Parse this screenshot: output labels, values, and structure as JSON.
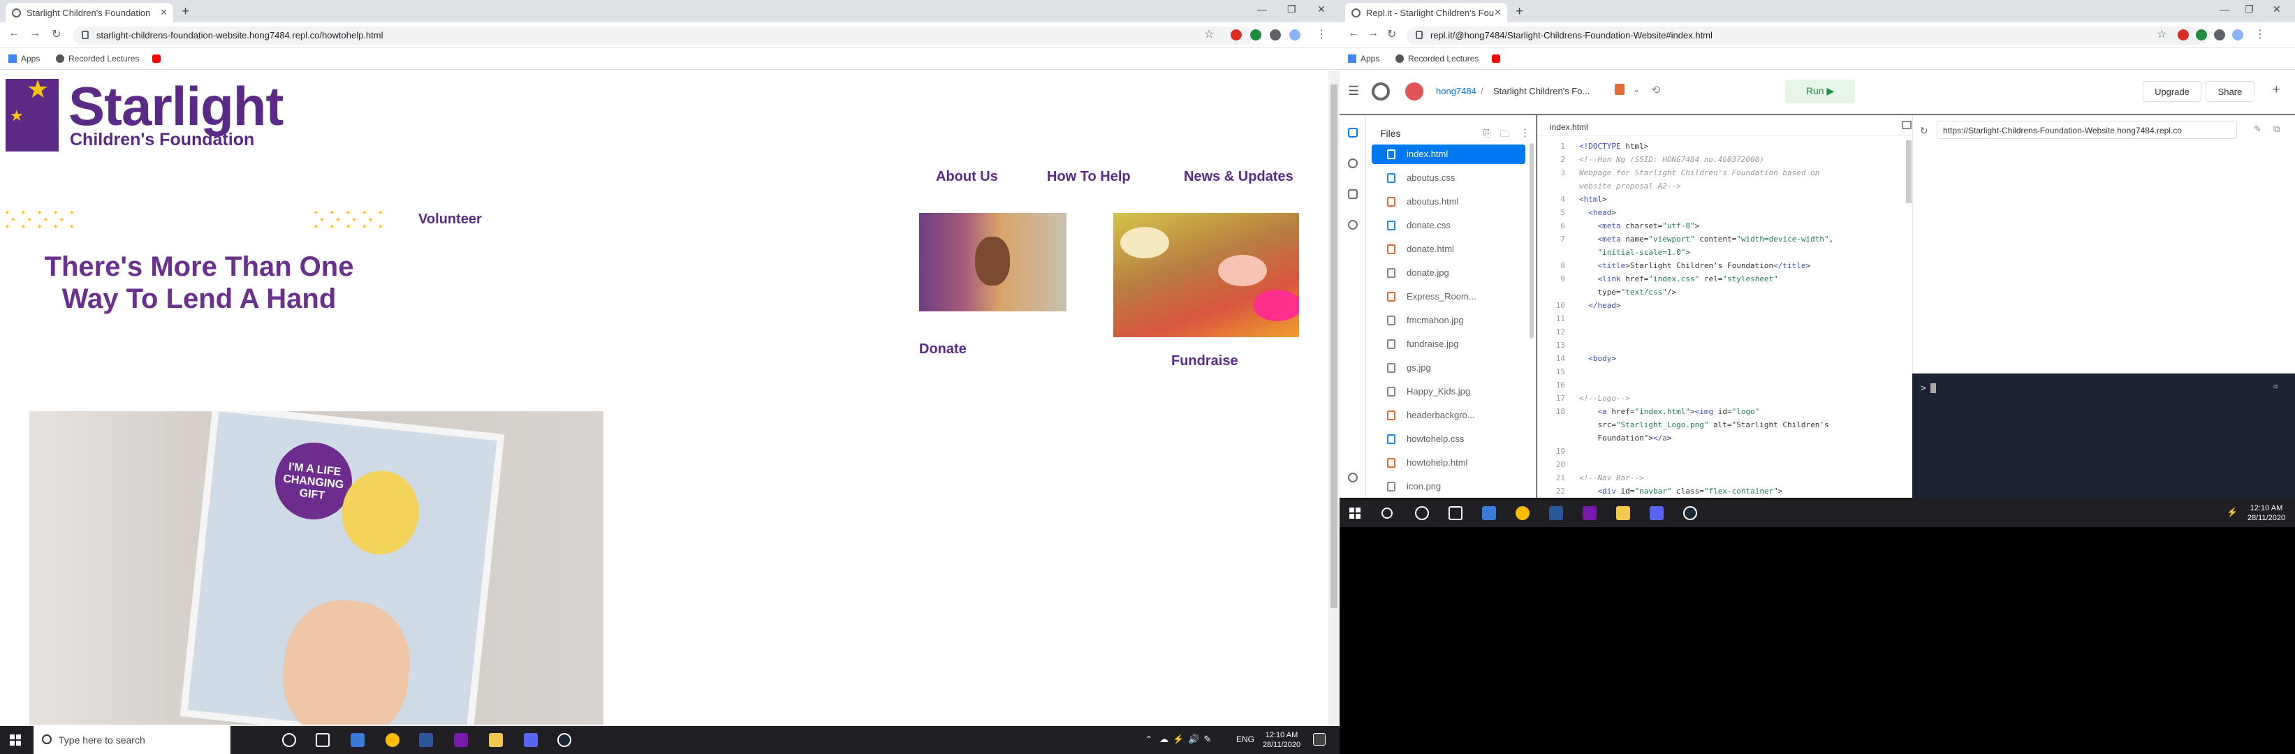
{
  "left": {
    "tab_title": "Starlight Children's Foundation",
    "url": "starlight-childrens-foundation-website.hong7484.repl.co/howtohelp.html",
    "bookmarks": [
      "Apps",
      "Recorded Lectures"
    ],
    "logo": {
      "line1": "Starlight",
      "line2": "Children's Foundation"
    },
    "nav": [
      "About Us",
      "How To Help",
      "News & Updates"
    ],
    "volunteer": "Volunteer",
    "headline": "There's More Than One Way To Lend A Hand",
    "donate": "Donate",
    "fundraise": "Fundraise",
    "badge": "I'M A LIFE CHANGING GIFT",
    "taskbar": {
      "search_placeholder": "Type here to search",
      "lang": "ENG",
      "time": "12:10 AM",
      "date": "28/11/2020"
    }
  },
  "right": {
    "tab_title": "Repl.it - Starlight Children's Fou",
    "url": "repl.it/@hong7484/Starlight-Childrens-Foundation-Website#index.html",
    "bookmarks": [
      "Apps",
      "Recorded Lectures"
    ],
    "user": "hong7484",
    "repl_name": "Starlight Children's Fo...",
    "run_label": "Run ▶",
    "upgrade_label": "Upgrade",
    "share_label": "Share",
    "files_title": "Files",
    "files": [
      "index.html",
      "aboutus.css",
      "aboutus.html",
      "donate.css",
      "donate.html",
      "donate.jpg",
      "Express_Room...",
      "fmcmahon.jpg",
      "fundraise.jpg",
      "gs.jpg",
      "Happy_Kids.jpg",
      "headerbackgro...",
      "howtohelp.css",
      "howtohelp.html",
      "icon.png"
    ],
    "editor_tab": "index.html",
    "web_url": "https://Starlight-Childrens-Foundation-Website.hong7484.repl.co",
    "console_prompt": ">",
    "taskbar": {
      "time": "12:10 AM",
      "date": "28/11/2020"
    }
  },
  "code_lines": [
    [
      "1",
      "<!DOCTYPE html>"
    ],
    [
      "2",
      "<!--Hon Ng (SSID: HONG7484 no.460372008)"
    ],
    [
      "3",
      "Webpage for Starlight Children's Foundation based on"
    ],
    [
      "",
      "website proposal A2-->"
    ],
    [
      "4",
      "<html>"
    ],
    [
      "5",
      "  <head>"
    ],
    [
      "6",
      "    <meta charset=\"utf-8\">"
    ],
    [
      "7",
      "    <meta name=\"viewport\" content=\"width=device-width\","
    ],
    [
      "",
      "    \"initial-scale=1.0\">"
    ],
    [
      "8",
      "    <title>Starlight Children's Foundation</title>"
    ],
    [
      "9",
      "    <link href=\"index.css\" rel=\"stylesheet\""
    ],
    [
      "",
      "    type=\"text/css\"/>"
    ],
    [
      "10",
      "  </head>"
    ],
    [
      "11",
      ""
    ],
    [
      "12",
      ""
    ],
    [
      "13",
      ""
    ],
    [
      "14",
      "  <body>"
    ],
    [
      "15",
      ""
    ],
    [
      "16",
      ""
    ],
    [
      "17",
      "<!--Logo-->"
    ],
    [
      "18",
      "    <a href=\"index.html\"><img id=\"logo\""
    ],
    [
      "",
      "    src=\"Starlight_Logo.png\" alt=\"Starlight Children's"
    ],
    [
      "",
      "    Foundation\"></a>"
    ],
    [
      "19",
      ""
    ],
    [
      "20",
      ""
    ],
    [
      "21",
      "<!--Nav Bar-->"
    ],
    [
      "22",
      "    <div id=\"navbar\" class=\"flex-container\">"
    ]
  ]
}
